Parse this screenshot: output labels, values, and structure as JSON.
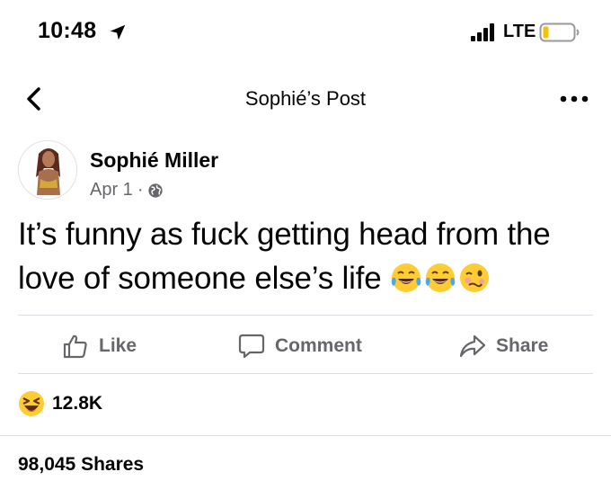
{
  "status_bar": {
    "time": "10:48",
    "network": "LTE",
    "icons": [
      "location-arrow-icon",
      "signal-icon",
      "battery-icon"
    ]
  },
  "header": {
    "title": "Sophié’s Post",
    "icons": [
      "back-chevron-icon",
      "more-options-icon"
    ]
  },
  "post": {
    "author_name": "Sophié Miller",
    "date": "Apr 1",
    "meta_separator": "·",
    "visibility_icon": "globe-icon",
    "text": "It’s funny as fuck getting head from the love of someone else’s life",
    "emojis": [
      "tears-of-joy-emoji",
      "tears-of-joy-emoji",
      "woozy-face-emoji"
    ]
  },
  "actions": {
    "like_label": "Like",
    "comment_label": "Comment",
    "share_label": "Share"
  },
  "reactions": {
    "icon": "laughing-squinting-face-emoji",
    "count": "12.8K"
  },
  "shares": {
    "label": "98,045 Shares"
  },
  "colors": {
    "text_primary": "#050505",
    "text_secondary": "#65676b",
    "divider": "#dadde1",
    "emoji_yellow": "#ffcc33"
  }
}
